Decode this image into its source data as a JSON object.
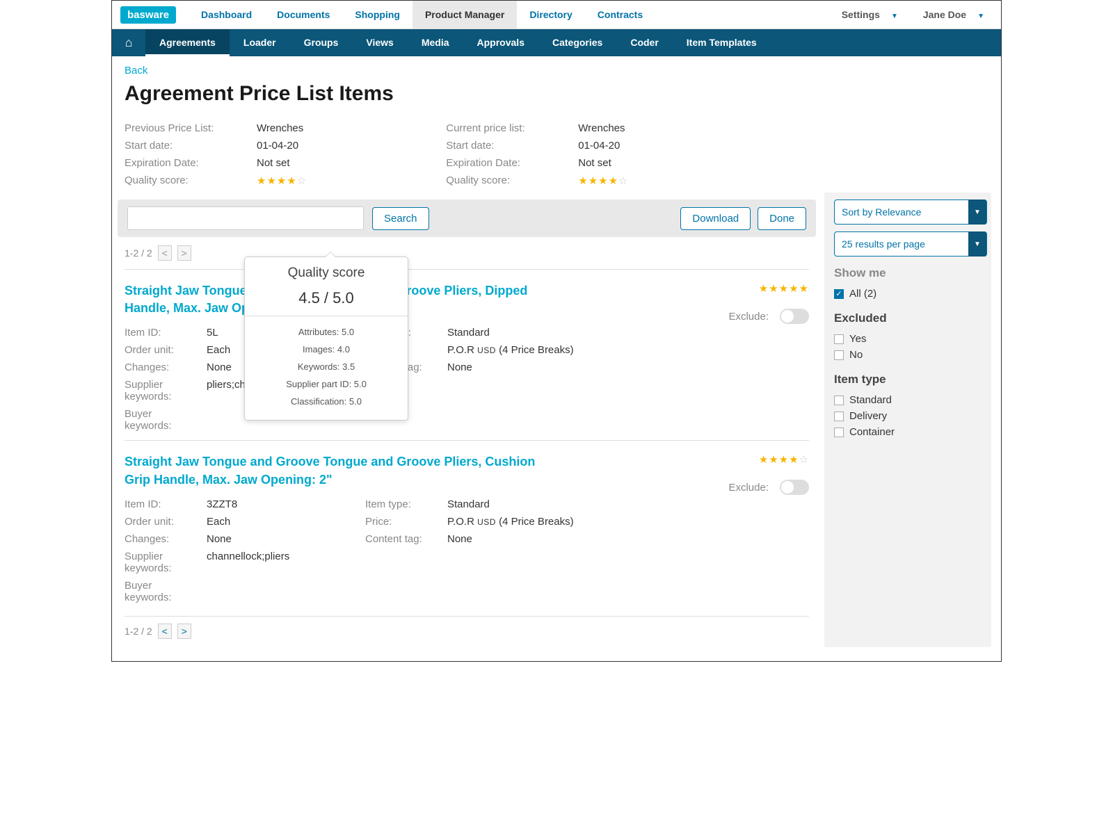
{
  "brand": "basware",
  "topnav": [
    "Dashboard",
    "Documents",
    "Shopping",
    "Product Manager",
    "Directory",
    "Contracts"
  ],
  "topnav_active": "Product Manager",
  "settings_label": "Settings",
  "user_name": "Jane Doe",
  "subnav": [
    "Agreements",
    "Loader",
    "Groups",
    "Views",
    "Media",
    "Approvals",
    "Categories",
    "Coder",
    "Item Templates"
  ],
  "subnav_active": "Agreements",
  "back_label": "Back",
  "page_title": "Agreement Price List Items",
  "prev": {
    "list_label": "Previous Price List:",
    "list": "Wrenches",
    "start_label": "Start date:",
    "start": "01-04-20",
    "exp_label": "Expiration Date:",
    "exp": "Not set",
    "q_label": "Quality score:"
  },
  "curr": {
    "list_label": "Current price list:",
    "list": "Wrenches",
    "start_label": "Start date:",
    "start": "01-04-20",
    "exp_label": "Expiration Date:",
    "exp": "Not set",
    "q_label": "Quality score:"
  },
  "search_btn": "Search",
  "download_btn": "Download",
  "done_btn": "Done",
  "sort_label": "Sort by Relevance",
  "perpage_label": "25 results per page",
  "pager": "1-2 / 2",
  "popover": {
    "title": "Quality score",
    "score": "4.5 / 5.0",
    "rows": [
      "Attributes: 5.0",
      "Images: 4.0",
      "Keywords: 3.5",
      "Supplier part ID: 5.0",
      "Classification: 5.0"
    ]
  },
  "items": [
    {
      "title": "Straight Jaw Tongue and Groove Tongue and Groove Pliers, Dipped Handle, Max. Jaw Opening: 2\"",
      "stars": 5,
      "item_id": "5L",
      "order_unit": "Each",
      "changes": "None",
      "supplier_kw": "pliers;channel locks",
      "buyer_kw": "",
      "item_type": "Standard",
      "price_prefix": "P.O.R ",
      "price_ccy": "USD",
      "price_breaks": "(4 Price Breaks)",
      "content_tag": "None"
    },
    {
      "title": "Straight Jaw Tongue and Groove Tongue and Groove Pliers, Cushion Grip Handle, Max. Jaw Opening: 2\"",
      "stars": 4,
      "item_id": "3ZZT8",
      "order_unit": "Each",
      "changes": "None",
      "supplier_kw": "channellock;pliers",
      "buyer_kw": "",
      "item_type": "Standard",
      "price_prefix": "P.O.R ",
      "price_ccy": "USD",
      "price_breaks": "(4 Price Breaks)",
      "content_tag": "None"
    }
  ],
  "labels": {
    "item_id": "Item ID:",
    "order_unit": "Order unit:",
    "changes": "Changes:",
    "supplier_kw": "Supplier keywords:",
    "buyer_kw": "Buyer keywords:",
    "item_type": "Item type:",
    "price": "Price:",
    "content_tag": "Content tag:",
    "exclude": "Exclude:"
  },
  "side": {
    "show_me": "Show me",
    "all": "All (2)",
    "excluded": "Excluded",
    "yes": "Yes",
    "no": "No",
    "item_type": "Item type",
    "standard": "Standard",
    "delivery": "Delivery",
    "container": "Container"
  }
}
